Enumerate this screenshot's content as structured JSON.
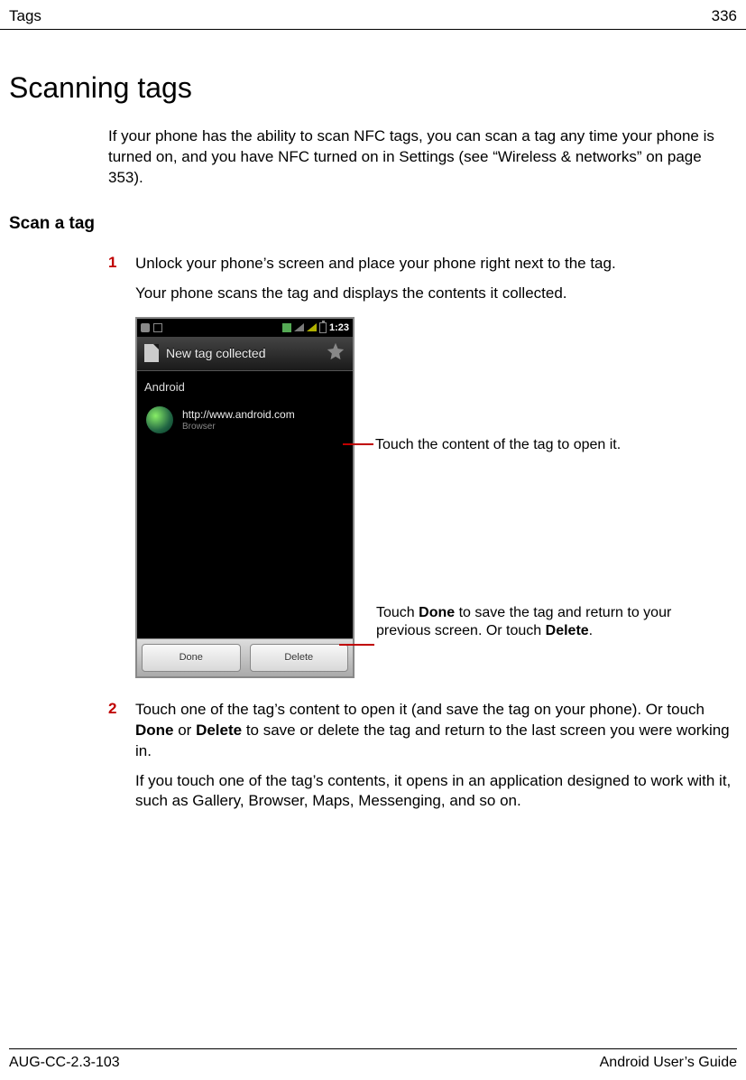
{
  "header": {
    "section": "Tags",
    "page_num": "336"
  },
  "h1": "Scanning tags",
  "intro": "If your phone has the ability to scan NFC tags, you can scan a tag any time your phone is turned on, and you have NFC turned on in Settings (see “Wireless & networks” on page 353).",
  "h2": "Scan a tag",
  "step1": {
    "num": "1",
    "text": "Unlock your phone’s screen and place your phone right next to the tag.",
    "sub": "Your phone scans the tag and displays the contents it collected."
  },
  "screenshot": {
    "status_time": "1:23",
    "titlebar": "New tag collected",
    "section": "Android",
    "link_url": "http://www.android.com",
    "link_app": "Browser",
    "btn_done": "Done",
    "btn_delete": "Delete"
  },
  "callouts": {
    "c1": "Touch the content of the tag to open it.",
    "c2_pre": "Touch ",
    "c2_bold1": "Done",
    "c2_mid": " to save the tag and return to your previous screen. Or touch ",
    "c2_bold2": "Delete",
    "c2_end": "."
  },
  "step2": {
    "num": "2",
    "pre": "Touch one of the tag’s content to open it (and save the tag on your phone). Or touch ",
    "b1": "Done",
    "mid": " or ",
    "b2": "Delete",
    "post": " to save or delete the tag and return to the last screen you were working in.",
    "sub": "If you touch one of the tag’s contents, it opens in an application designed to work with it, such as Gallery, Browser, Maps, Messenging, and so on."
  },
  "footer": {
    "left": "AUG-CC-2.3-103",
    "right": "Android User’s Guide"
  }
}
